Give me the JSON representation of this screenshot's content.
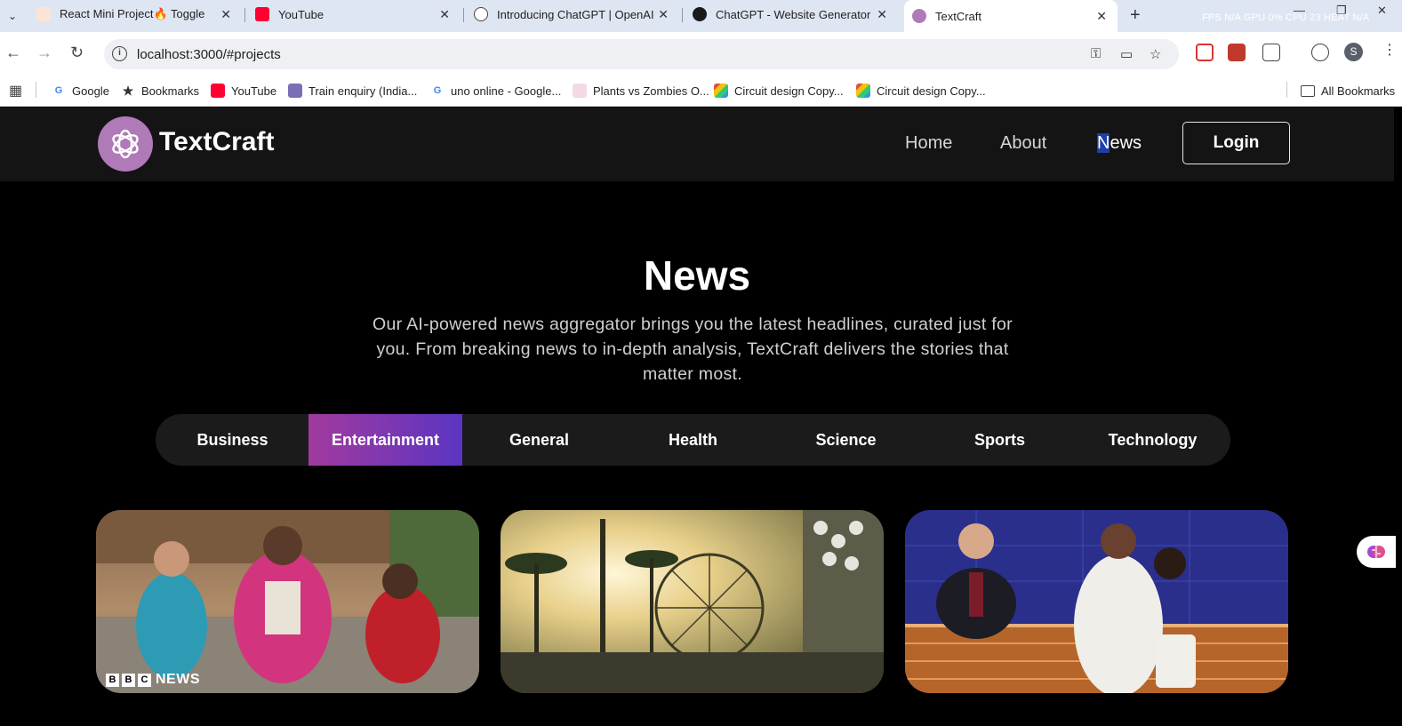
{
  "browser": {
    "tabs": [
      {
        "title": "React Mini Project🔥 Toggle Sw",
        "active": false
      },
      {
        "title": "YouTube",
        "active": false
      },
      {
        "title": "Introducing ChatGPT | OpenAI",
        "active": false
      },
      {
        "title": "ChatGPT - Website Generator",
        "active": false
      },
      {
        "title": "TextCraft",
        "active": true
      }
    ],
    "stats_text": "FPS N/A GPU 0% CPU 23 HEAT N/A",
    "url": "localhost:3000/#projects",
    "profile_initial": "S",
    "bookmarks": [
      {
        "label": "Google",
        "icon": "google-icon"
      },
      {
        "label": "Bookmarks",
        "icon": "star-icon"
      },
      {
        "label": "YouTube",
        "icon": "youtube-icon"
      },
      {
        "label": "Train enquiry (India...",
        "icon": "train-icon"
      },
      {
        "label": "uno online - Google...",
        "icon": "google-icon"
      },
      {
        "label": "Plants vs Zombies O...",
        "icon": "game-icon"
      },
      {
        "label": "Circuit design Copy...",
        "icon": "grid-icon"
      },
      {
        "label": "Circuit design Copy...",
        "icon": "grid-icon"
      }
    ],
    "all_bookmarks": "All Bookmarks"
  },
  "site": {
    "brand": "TextCraft",
    "nav": {
      "home": "Home",
      "about": "About",
      "news_first": "N",
      "news_rest": "ews",
      "login": "Login"
    },
    "hero": {
      "title": "News",
      "description": "Our AI-powered news aggregator brings you the latest headlines, curated just for you. From breaking news to in-depth analysis, TextCraft delivers the stories that matter most."
    },
    "categories": [
      "Business",
      "Entertainment",
      "General",
      "Health",
      "Science",
      "Sports",
      "Technology"
    ],
    "active_category": "Entertainment",
    "cards": [
      {
        "image": "movie-still-image",
        "source_badge": [
          "B",
          "B",
          "C"
        ],
        "source_text": "NEWS"
      },
      {
        "image": "festival-ferris-wheel-image"
      },
      {
        "image": "news-desk-show-image"
      }
    ]
  },
  "colors": {
    "accent_gradient_start": "#a23a9e",
    "accent_gradient_end": "#5b35c2",
    "logo_bg": "#b07ab9",
    "nav_bg": "#141414"
  }
}
